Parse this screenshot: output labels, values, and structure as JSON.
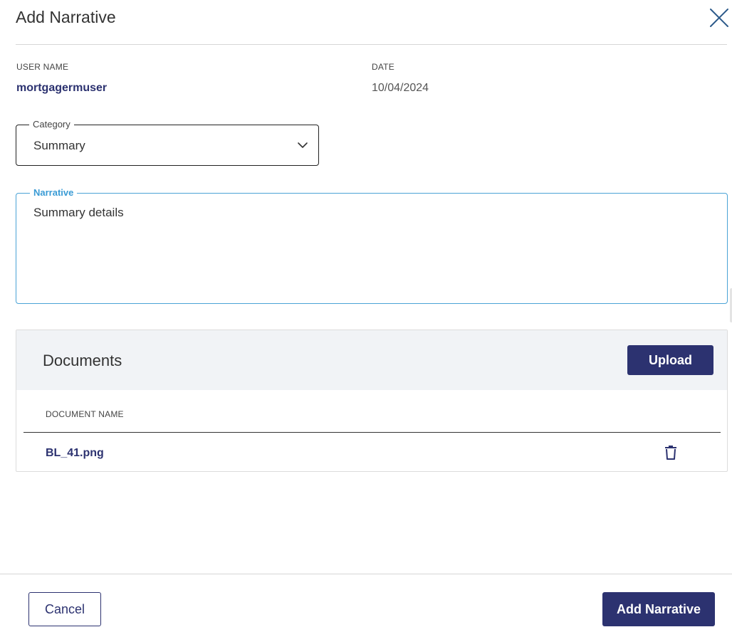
{
  "dialog": {
    "title": "Add Narrative"
  },
  "meta": {
    "user_label": "USER NAME",
    "user_value": "mortgagermuser",
    "date_label": "DATE",
    "date_value": "10/04/2024"
  },
  "category": {
    "label": "Category",
    "value": "Summary"
  },
  "narrative": {
    "label": "Narrative",
    "value": "Summary details"
  },
  "documents": {
    "title": "Documents",
    "upload_label": "Upload",
    "column_header": "DOCUMENT NAME",
    "rows": [
      {
        "name": "BL_41.png"
      }
    ]
  },
  "footer": {
    "cancel_label": "Cancel",
    "submit_label": "Add Narrative"
  },
  "icons": {
    "close": "close-icon",
    "chevron": "chevron-down-icon",
    "trash": "trash-icon"
  },
  "colors": {
    "primary": "#2c3270",
    "focus": "#3a9bd5",
    "header_bg": "#f1f3f6"
  }
}
